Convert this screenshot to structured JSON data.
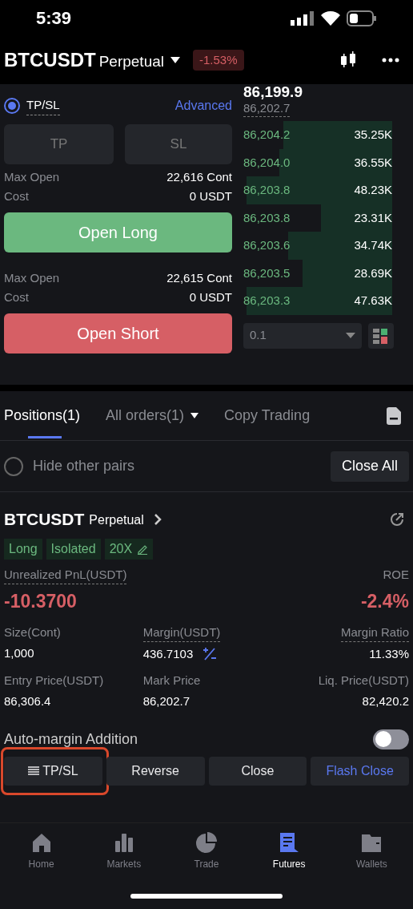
{
  "status_bar": {
    "time": "5:39"
  },
  "header": {
    "symbol": "BTCUSDT",
    "contract": "Perpetual",
    "change": "-1.53%"
  },
  "order_form": {
    "mode": {
      "label": "TP/SL",
      "selected": true
    },
    "advanced": "Advanced",
    "tp_placeholder": "TP",
    "sl_placeholder": "SL",
    "long": {
      "max_open_label": "Max Open",
      "max_open": "22,616 Cont",
      "cost_label": "Cost",
      "cost": "0 USDT",
      "button": "Open Long"
    },
    "short": {
      "max_open_label": "Max Open",
      "max_open": "22,615 Cont",
      "cost_label": "Cost",
      "cost": "0 USDT",
      "button": "Open Short"
    }
  },
  "order_book": {
    "last_price": "86,199.9",
    "mark_price": "86,202.7",
    "rows": [
      {
        "price": "86,204.2",
        "amount": "35.25K"
      },
      {
        "price": "86,204.0",
        "amount": "36.55K"
      },
      {
        "price": "86,203.8",
        "amount": "48.23K"
      },
      {
        "price": "86,203.8",
        "amount": "23.31K"
      },
      {
        "price": "86,203.6",
        "amount": "34.74K"
      },
      {
        "price": "86,203.5",
        "amount": "28.69K"
      },
      {
        "price": "86,203.3",
        "amount": "47.63K"
      }
    ],
    "precision": "0.1"
  },
  "tabs": [
    {
      "label": "Positions(1)",
      "selected": true,
      "dropdown": false
    },
    {
      "label": "All orders(1)",
      "selected": false,
      "dropdown": true
    },
    {
      "label": "Copy Trading",
      "selected": false,
      "dropdown": false
    }
  ],
  "filter": {
    "label": "Hide other pairs",
    "checked": false,
    "close_all": "Close All"
  },
  "position": {
    "symbol": "BTCUSDT",
    "contract": "Perpetual",
    "tags": [
      "Long",
      "Isolated",
      "20X"
    ],
    "pnl_label": "Unrealized PnL(USDT)",
    "pnl": "-10.3700",
    "roe_label": "ROE",
    "roe": "-2.4%",
    "stats": [
      {
        "label": "Size(Cont)",
        "value": "1,000"
      },
      {
        "label": "Margin(USDT)",
        "value": "436.7103"
      },
      {
        "label": "Margin Ratio",
        "value": "11.33%"
      },
      {
        "label": "Entry Price(USDT)",
        "value": "86,306.4"
      },
      {
        "label": "Mark Price",
        "value": "86,202.7"
      },
      {
        "label": "Liq. Price(USDT)",
        "value": "82,420.2"
      }
    ],
    "auto_margin": {
      "label": "Auto-margin Addition",
      "on": false
    },
    "actions": [
      {
        "label": "TP/SL",
        "kind": "menu",
        "highlighted": true
      },
      {
        "label": "Reverse",
        "kind": "plain",
        "highlighted": false
      },
      {
        "label": "Close",
        "kind": "plain",
        "highlighted": false
      },
      {
        "label": "Flash Close",
        "kind": "accent",
        "highlighted": false
      }
    ]
  },
  "bottom_nav": [
    {
      "label": "Home",
      "selected": false
    },
    {
      "label": "Markets",
      "selected": false
    },
    {
      "label": "Trade",
      "selected": false
    },
    {
      "label": "Futures",
      "selected": true
    },
    {
      "label": "Wallets",
      "selected": false
    }
  ]
}
